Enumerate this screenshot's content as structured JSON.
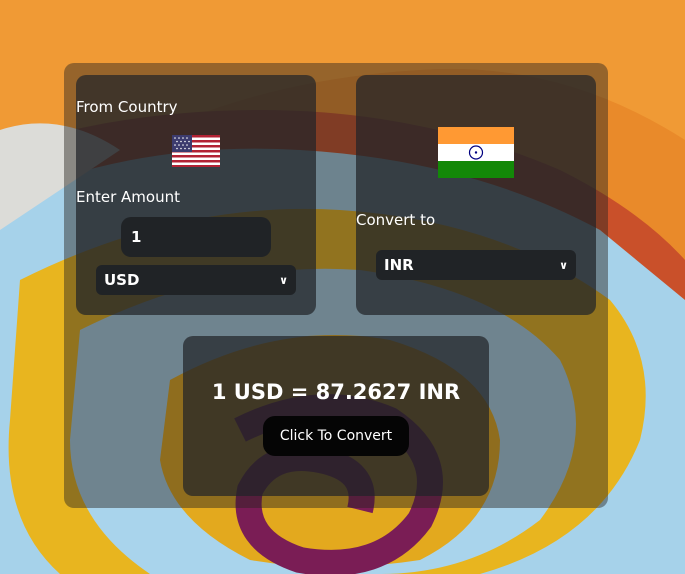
{
  "from": {
    "heading": "From Country",
    "flag_icon": "us-flag-icon",
    "amount_label": "Enter Amount",
    "amount_value": "1",
    "currency": "USD"
  },
  "to": {
    "flag_icon": "india-flag-icon",
    "heading": "Convert to",
    "currency": "INR"
  },
  "result": {
    "text": "1 USD = 87.2627 INR",
    "button_label": "Click To Convert"
  },
  "colors": {
    "panel": "#212428",
    "input": "#202326",
    "button": "#050505"
  }
}
